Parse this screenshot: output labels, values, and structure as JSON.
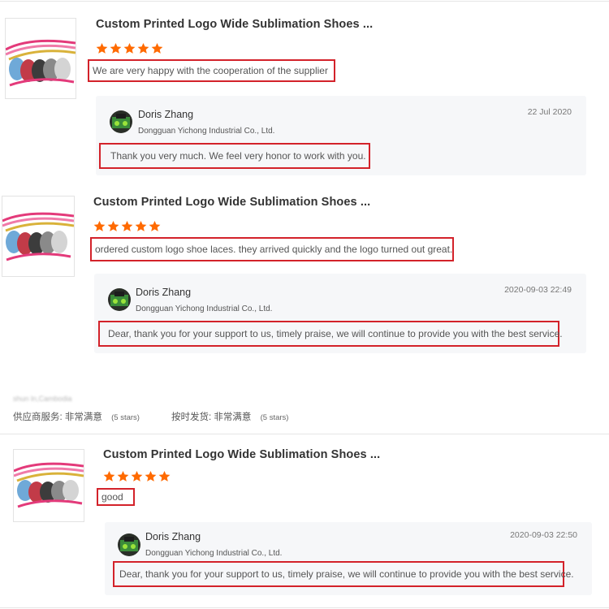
{
  "reviews": [
    {
      "product_title": "Custom Printed Logo Wide Sublimation Shoes ...",
      "rating": 5,
      "comment": "We are very happy with the cooperation of the supplier",
      "reply": {
        "name": "Doris Zhang",
        "company": "Dongguan Yichong Industrial Co., Ltd.",
        "date": "22 Jul 2020",
        "text": "Thank you very much. We feel very honor to work with you."
      }
    },
    {
      "product_title": "Custom Printed Logo Wide Sublimation Shoes ...",
      "rating": 5,
      "comment": "ordered custom logo shoe laces. they arrived quickly and the logo turned out great.",
      "reply": {
        "name": "Doris Zhang",
        "company": "Dongguan Yichong Industrial Co., Ltd.",
        "date": "2020-09-03 22:49",
        "text": "Dear, thank you for your support to us, timely praise, we will continue to provide you with the best service."
      }
    },
    {
      "product_title": "Custom Printed Logo Wide Sublimation Shoes ...",
      "rating": 5,
      "comment": "good",
      "reply": {
        "name": "Doris Zhang",
        "company": "Dongguan Yichong Industrial Co., Ltd.",
        "date": "2020-09-03 22:50",
        "text": "Dear, thank you for your support to us, timely praise, we will continue to provide you with the best service."
      }
    }
  ],
  "buyer_meta": {
    "blurred_location": "shun ln,Cambodia",
    "supplier_service_label": "供应商服务:",
    "supplier_service_value": "非常满意",
    "supplier_service_count": "(5 stars)",
    "shipping_label": "按时发货:",
    "shipping_value": "非常满意",
    "shipping_count": "(5 stars)"
  },
  "colors": {
    "star": "#ff6a00",
    "highlight_box": "#d3222a",
    "reply_bg": "#f6f7f9"
  },
  "icons": {
    "star": "star-icon",
    "avatar": "supplier-avatar"
  }
}
